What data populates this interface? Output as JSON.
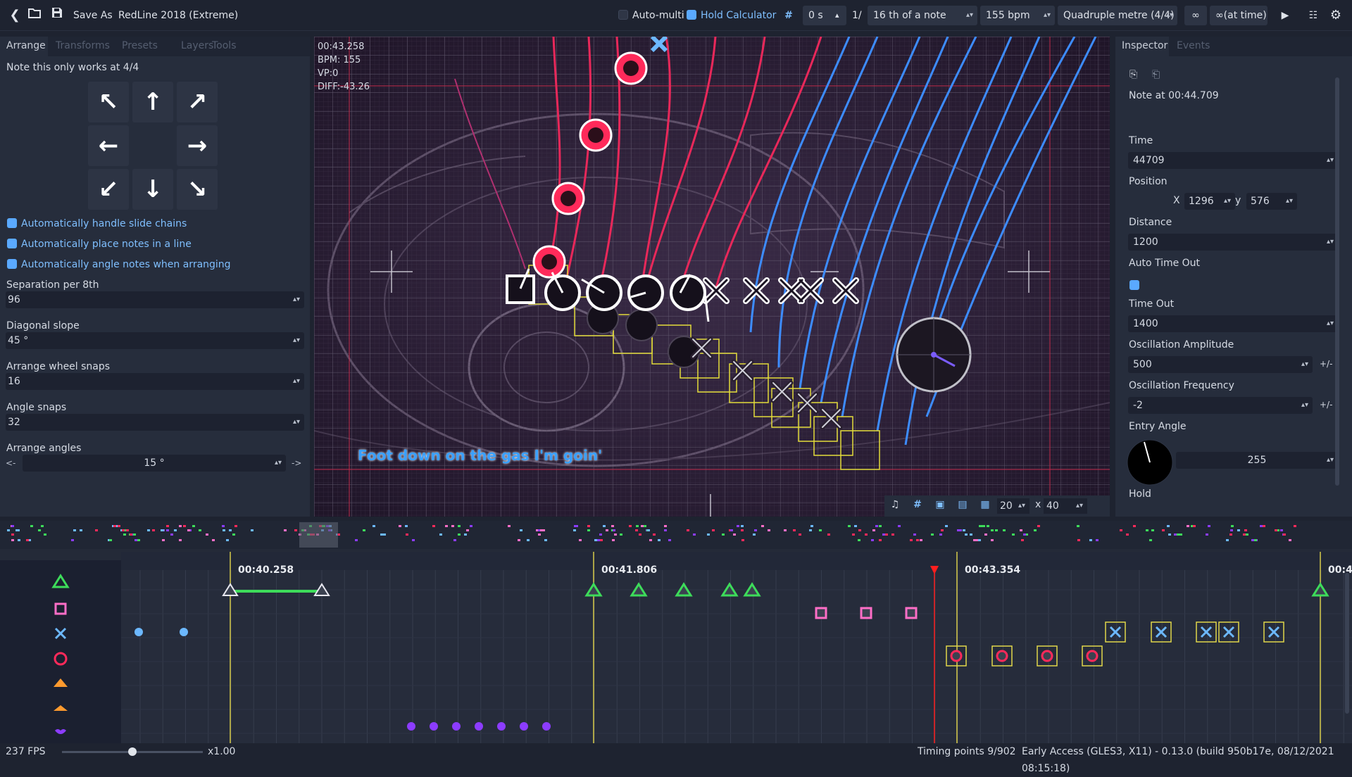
{
  "topbar": {
    "save_as": "Save As",
    "song_title": "RedLine 2018 (Extreme)",
    "auto_multi": "Auto-multi",
    "hold_calculator": "Hold Calculator",
    "offset_value": "0 s",
    "fraction_prefix": "1/",
    "snap_value": "16 th of a note",
    "bpm_value": "155 bpm",
    "metre_value": "Quadruple metre (4/4)",
    "at_time": "(at time)"
  },
  "left_panel": {
    "tabs": [
      "Arrange",
      "Transforms",
      "Presets",
      "Layers",
      "Tools"
    ],
    "note": "Note this only works at 4/4",
    "cb_slide_chains": "Automatically handle slide chains",
    "cb_place_line": "Automatically place notes in a line",
    "cb_angle_notes": "Automatically angle notes when arranging",
    "separation_label": "Separation per 8th",
    "separation_value": "96",
    "diagonal_label": "Diagonal slope",
    "diagonal_value": "45 °",
    "wheel_label": "Arrange wheel snaps",
    "wheel_value": "16",
    "angle_snaps_label": "Angle snaps",
    "angle_snaps_value": "32",
    "arrange_angles_label": "Arrange angles",
    "angle_left": "<-",
    "angle_value": "15 °",
    "angle_right": "->"
  },
  "canvas": {
    "time": "00:43.258",
    "bpm": "BPM: 155",
    "vp": "VP:0",
    "diff": "DIFF:-43.26",
    "lyric": "Foot down on the gas I'm goin'",
    "grid_x": "20",
    "grid_sep": "x",
    "grid_y": "40"
  },
  "inspector": {
    "tabs": [
      "Inspector",
      "Events"
    ],
    "note_title": "Note at 00:44.709",
    "time_label": "Time",
    "time_value": "44709",
    "position_label": "Position",
    "x_label": "X",
    "x_value": "1296",
    "y_label": "y",
    "y_value": "576",
    "distance_label": "Distance",
    "distance_value": "1200",
    "auto_timeout_label": "Auto Time Out",
    "timeout_label": "Time Out",
    "timeout_value": "1400",
    "osc_amp_label": "Oscillation Amplitude",
    "osc_amp_value": "500",
    "osc_freq_label": "Oscillation Frequency",
    "osc_freq_value": "-2",
    "pm": "+/-",
    "entry_angle_label": "Entry Angle",
    "entry_angle_value": "255",
    "hold_label": "Hold"
  },
  "timeline": {
    "markers": [
      "00:40.258",
      "00:41.806",
      "00:43.354",
      "00:4"
    ]
  },
  "status": {
    "fps": "237 FPS",
    "speed": "x1.00",
    "timing_points": "Timing points 9/902",
    "build": "Early Access (GLES3, X11) - 0.13.0 (build 950b17e, 08/12/2021 08:15:18)"
  },
  "colors": {
    "accent_blue": "#5aa9ff",
    "triangle_green": "#3ddc5a",
    "square_pink": "#ff6ec7",
    "cross_blue": "#6cb8ff",
    "circle_red": "#ff2a5a",
    "playhead_red": "#ff1e1e",
    "beat_yellow": "#e0d64a"
  }
}
